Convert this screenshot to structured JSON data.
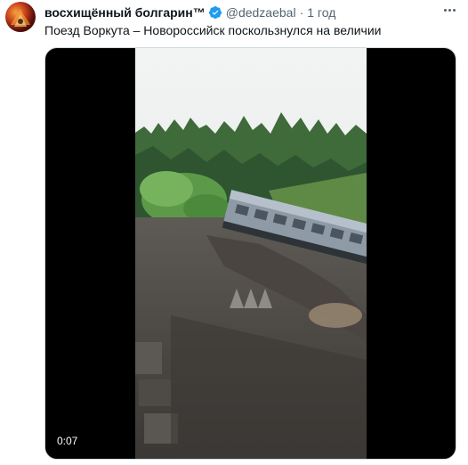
{
  "tweet": {
    "display_name": "восхищённый болгарин™",
    "handle": "@dedzaebal",
    "separator": "·",
    "time": "1 год",
    "text": "Поезд Воркута – Новороссийск поскользнулся на величии",
    "verified": true
  },
  "media": {
    "type": "video",
    "duration": "0:07"
  },
  "icons": {
    "verified": "verified-badge-icon",
    "more": "more-options-icon"
  },
  "colors": {
    "verified_blue": "#1d9bf0",
    "secondary_text": "#536471"
  }
}
